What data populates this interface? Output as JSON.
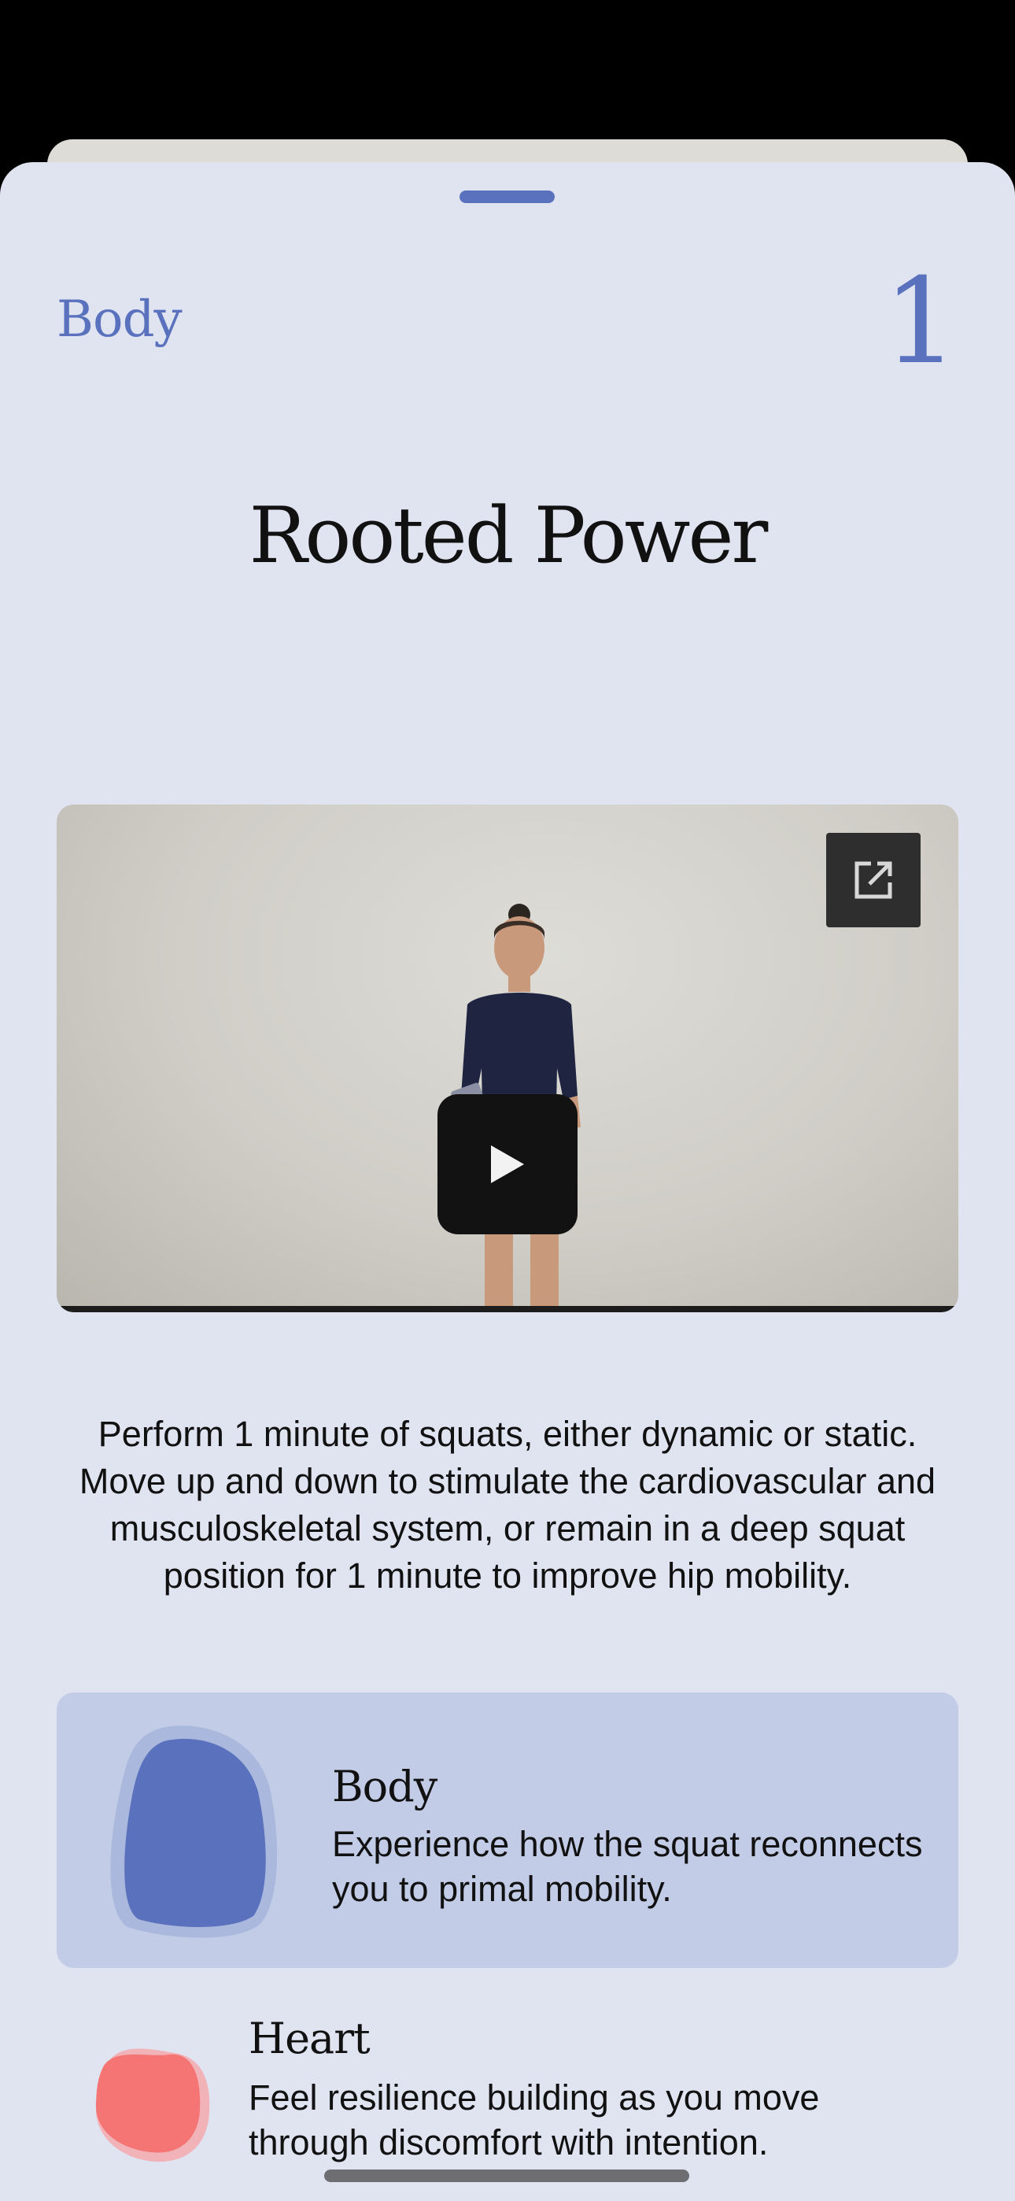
{
  "header": {
    "category": "Body",
    "step_number": "1"
  },
  "exercise": {
    "title": "Rooted Power",
    "description": "Perform 1 minute of squats, either dynamic or static. Move up and down to stimulate the cardiovascular and musculoskeletal system, or remain in a deep squat position for 1 minute to improve hip mobility."
  },
  "icons": {
    "favorite": "heart-outline-icon",
    "open_external": "external-link-icon",
    "play": "play-icon"
  },
  "benefits": [
    {
      "title": "Body",
      "text": "Experience how the squat reconnects you to primal mobility.",
      "color": "#5a72bd"
    },
    {
      "title": "Heart",
      "text": "Feel resilience building as you move through discomfort with intention.",
      "color": "#f47574"
    }
  ],
  "colors": {
    "accent": "#5a72bd",
    "sheet_background": "#e0e4f1",
    "body_card_background": "#c2cce6",
    "heart_accent": "#f47574"
  }
}
